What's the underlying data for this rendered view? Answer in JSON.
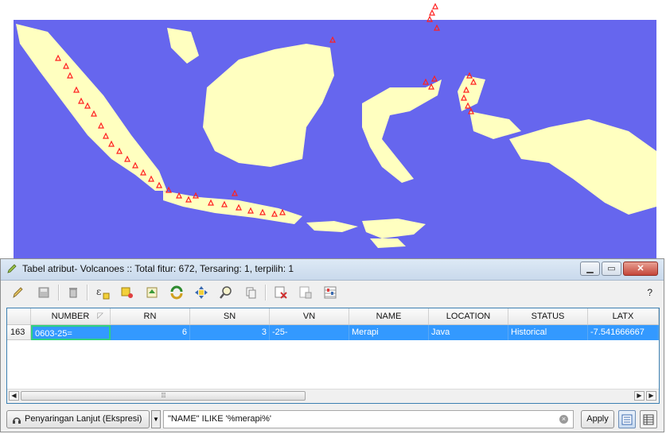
{
  "map": {
    "sea_color": "#6666ee",
    "land_color": "#ffffc0",
    "marker_color": "#ff2020",
    "marker_symbol": "triangle-outline"
  },
  "window": {
    "title": "Tabel atribut- Volcanoes :: Total fitur: 672, Tersaring: 1, terpilih: 1",
    "minimize_icon": "minimize-icon",
    "maximize_icon": "maximize-icon",
    "close_icon": "close-icon"
  },
  "toolbar": {
    "items": [
      "pencil-edit-icon",
      "save-icon",
      "delete-icon",
      "field-calculator-icon",
      "select-expression-icon",
      "move-top-icon",
      "invert-selection-icon",
      "pan-to-selection-icon",
      "zoom-to-selection-icon",
      "copy-icon",
      "delete-column-icon",
      "new-column-icon",
      "organize-columns-icon"
    ],
    "help_label": "?"
  },
  "table": {
    "columns": [
      "NUMBER",
      "RN",
      "SN",
      "VN",
      "NAME",
      "LOCATION",
      "STATUS",
      "LATX"
    ],
    "rows": [
      {
        "row_number": "163",
        "NUMBER": "0603-25=",
        "RN": "6",
        "SN": "3",
        "VN": "-25-",
        "NAME": "Merapi",
        "LOCATION": "Java",
        "STATUS": "Historical",
        "LATX": "-7.541666667"
      }
    ],
    "selected_color": "#3399ff"
  },
  "filter": {
    "advanced_filter_label": "Penyaringan Lanjut (Ekspresi)",
    "expression": "\"NAME\" ILIKE '%merapi%'",
    "apply_label": "Apply"
  }
}
